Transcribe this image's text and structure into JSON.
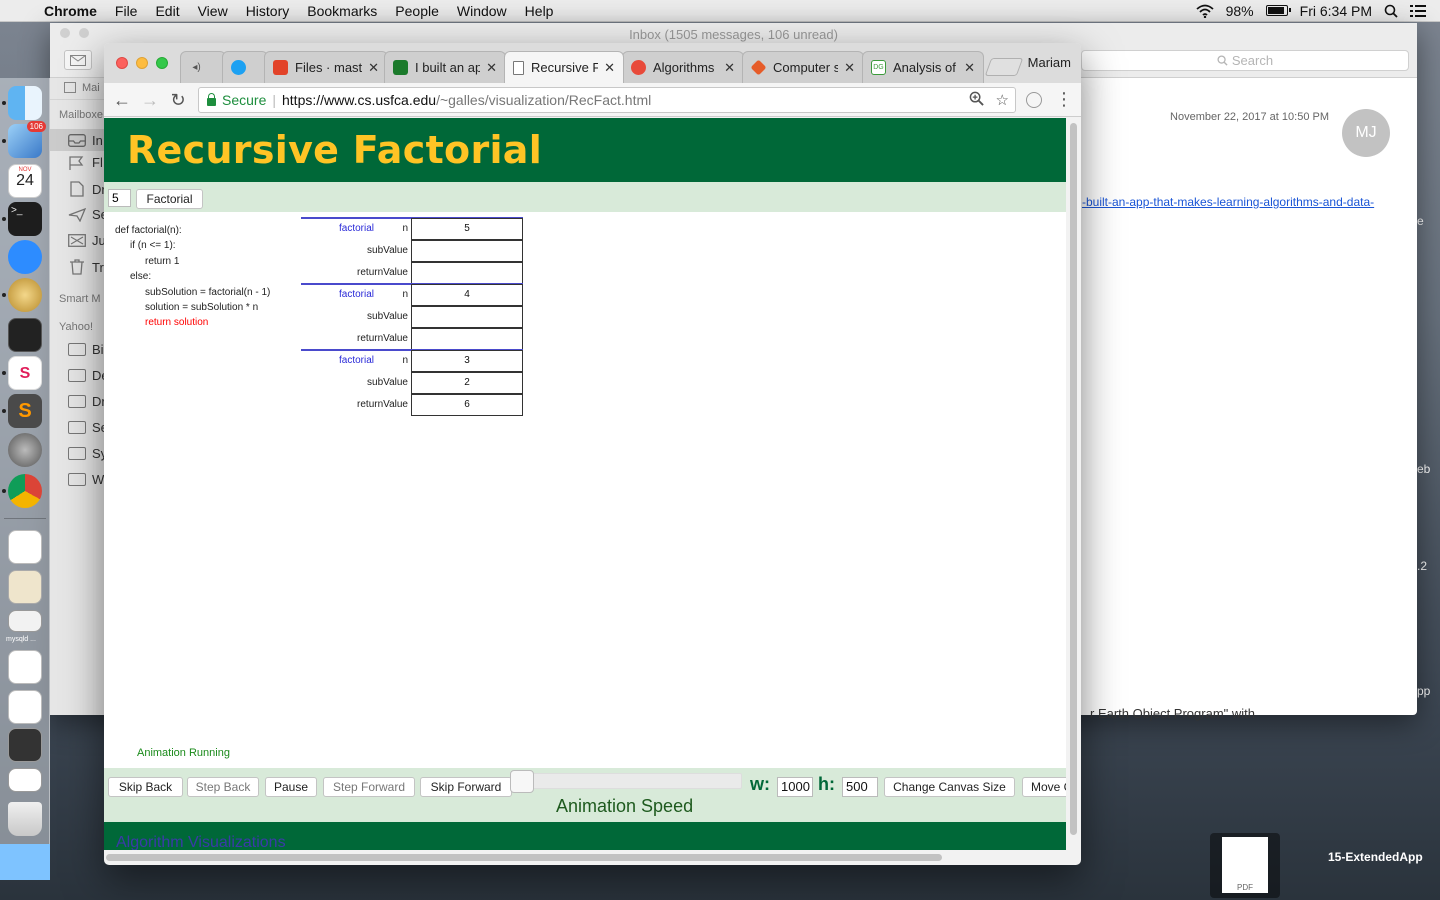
{
  "menubar": {
    "app": "Chrome",
    "items": [
      "File",
      "Edit",
      "View",
      "History",
      "Bookmarks",
      "People",
      "Window",
      "Help"
    ],
    "battery": "98%",
    "clock": "Fri 6:34 PM"
  },
  "dock": {
    "mail_badge": "106",
    "calendar_month": "NOV",
    "calendar_day": "24",
    "mysqld_label": "mysqld ..."
  },
  "mail": {
    "title": "Inbox (1505 messages, 106 unread)",
    "search_placeholder": "Search",
    "sidebar": {
      "mailboxes_header": "Mailboxe",
      "items": [
        "In",
        "Fl",
        "Dr",
        "Se",
        "Ju",
        "Tr"
      ],
      "smart_header": "Smart M",
      "yahoo_header": "Yahoo!",
      "folders": [
        "Bi",
        "De",
        "Dr",
        "Se",
        "Sy",
        "W"
      ]
    },
    "toolbar_mail_label": "Mai",
    "date": "November 22, 2017 at 10:50 PM",
    "avatar_initials": "MJ",
    "link": "-built-an-app-that-makes-learning-algorithms-and-data-",
    "body_fragment": "r Earth Object Program\" with"
  },
  "desktop": {
    "frag1": "e",
    "frag2": "eb",
    "frag3": ".2",
    "frag4": "pp",
    "pdf_label": "PDF",
    "file_label": "15-ExtendedApp"
  },
  "browser": {
    "profile": "Mariam",
    "tabs": [
      {
        "title": "",
        "icon": "speaker-icon"
      },
      {
        "title": "",
        "icon": "twitter-icon"
      },
      {
        "title": "Files · mast",
        "icon": "gitlab-icon"
      },
      {
        "title": "I built an ap",
        "icon": "app-icon"
      },
      {
        "title": "Recursive F",
        "icon": "page-icon"
      },
      {
        "title": "Algorithms",
        "icon": "code-icon"
      },
      {
        "title": "Computer s",
        "icon": "diamond-icon"
      },
      {
        "title": "Analysis of",
        "icon": "dg-icon"
      }
    ],
    "omnibox": {
      "secure": "Secure",
      "url_host": "https://www.cs.usfca.edu",
      "url_path": "/~galles/visualization/RecFact.html"
    }
  },
  "visualization": {
    "title": "Recursive Factorial",
    "input_value": "5",
    "factorial_button": "Factorial",
    "code": [
      "def factorial(n):",
      "if (n <= 1):",
      "return 1",
      "else:",
      "subSolution = factorial(n - 1)",
      "solution = subSolution * n",
      "return solution"
    ],
    "frames": [
      {
        "fn": "factorial",
        "n_label": "n",
        "n": "5",
        "sub_label": "subValue",
        "sub": "",
        "ret_label": "returnValue",
        "ret": ""
      },
      {
        "fn": "factorial",
        "n_label": "n",
        "n": "4",
        "sub_label": "subValue",
        "sub": "",
        "ret_label": "returnValue",
        "ret": ""
      },
      {
        "fn": "factorial",
        "n_label": "n",
        "n": "3",
        "sub_label": "subValue",
        "sub": "2",
        "ret_label": "returnValue",
        "ret": "6"
      }
    ],
    "status": "Animation Running",
    "controls": {
      "skip_back": "Skip Back",
      "step_back": "Step Back",
      "pause": "Pause",
      "step_forward": "Step Forward",
      "skip_forward": "Skip Forward",
      "speed_label": "Animation Speed",
      "w_label": "w:",
      "w_value": "1000",
      "h_label": "h:",
      "h_value": "500",
      "change_canvas": "Change Canvas Size",
      "move": "Move C"
    },
    "footer_link": "Algorithm Visualizations"
  }
}
